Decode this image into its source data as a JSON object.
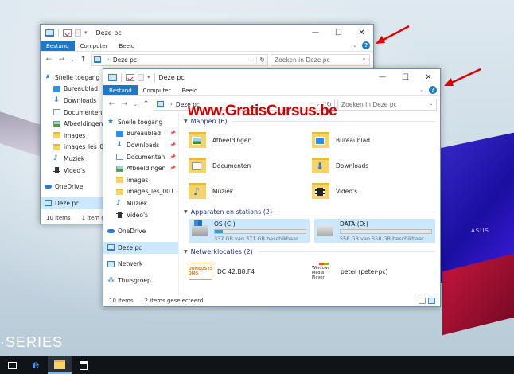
{
  "desktop": {
    "series_text": "SERIES",
    "asus_logo": "ASUS"
  },
  "watermark": "www.GratisCursus.be",
  "accent": "#1979ca",
  "back_window": {
    "title": "Deze pc",
    "ribbon_tabs": [
      "Bestand",
      "Computer",
      "Beeld"
    ],
    "address": "Deze pc",
    "search_placeholder": "Zoeken in Deze pc",
    "nav": [
      {
        "label": "Snelle toegang",
        "icon": "star-icon"
      },
      {
        "label": "Bureaublad",
        "icon": "desktop-icon"
      },
      {
        "label": "Downloads",
        "icon": "download-icon"
      },
      {
        "label": "Documenten",
        "icon": "documents-icon"
      },
      {
        "label": "Afbeeldingen",
        "icon": "pictures-icon"
      },
      {
        "label": "images",
        "icon": "folder-icon"
      },
      {
        "label": "images_les_001",
        "icon": "folder-icon"
      },
      {
        "label": "Muziek",
        "icon": "music-icon"
      },
      {
        "label": "Video's",
        "icon": "video-icon"
      },
      {
        "label": "OneDrive",
        "icon": "cloud-icon"
      },
      {
        "label": "Deze pc",
        "icon": "pc-icon"
      }
    ],
    "status_items": "10 items",
    "status_selected": "1 item ge"
  },
  "front_window": {
    "title": "Deze pc",
    "ribbon_tabs": [
      "Bestand",
      "Computer",
      "Beeld"
    ],
    "address": "Deze pc",
    "search_placeholder": "Zoeken in Deze pc",
    "nav": [
      {
        "label": "Snelle toegang",
        "icon": "star-icon",
        "pinned": false
      },
      {
        "label": "Bureaublad",
        "icon": "desktop-icon",
        "pinned": true
      },
      {
        "label": "Downloads",
        "icon": "download-icon",
        "pinned": true
      },
      {
        "label": "Documenten",
        "icon": "documents-icon",
        "pinned": true
      },
      {
        "label": "Afbeeldingen",
        "icon": "pictures-icon",
        "pinned": true
      },
      {
        "label": "images",
        "icon": "folder-icon",
        "pinned": false
      },
      {
        "label": "images_les_001",
        "icon": "folder-icon",
        "pinned": false
      },
      {
        "label": "Muziek",
        "icon": "music-icon",
        "pinned": false
      },
      {
        "label": "Video's",
        "icon": "video-icon",
        "pinned": false
      },
      {
        "label": "OneDrive",
        "icon": "cloud-icon",
        "pinned": false
      },
      {
        "label": "Deze pc",
        "icon": "pc-icon",
        "pinned": false
      },
      {
        "label": "Netwerk",
        "icon": "network-icon",
        "pinned": false
      },
      {
        "label": "Thuisgroep",
        "icon": "homegroup-icon",
        "pinned": false
      }
    ],
    "groups": {
      "folders_header": "Mappen (6)",
      "folders": [
        {
          "label": "Afbeeldingen",
          "icon": "pictures-folder-icon"
        },
        {
          "label": "Bureaublad",
          "icon": "desktop-folder-icon"
        },
        {
          "label": "Documenten",
          "icon": "documents-folder-icon"
        },
        {
          "label": "Downloads",
          "icon": "downloads-folder-icon"
        },
        {
          "label": "Muziek",
          "icon": "music-folder-icon"
        },
        {
          "label": "Video's",
          "icon": "videos-folder-icon"
        }
      ],
      "drives_header": "Apparaten en stations (2)",
      "drives": [
        {
          "label": "OS (C:)",
          "free": "337 GB van 371 GB beschikbaar",
          "used_fraction": 0.09,
          "icon": "windows-drive-icon"
        },
        {
          "label": "DATA (D:)",
          "free": "558 GB van 558 GB beschikbaar",
          "used_fraction": 0.0,
          "icon": "hard-drive-icon"
        }
      ],
      "netloc_header": "Netwerklocaties (2)",
      "netlocs": [
        {
          "label": "DC 42:B8:F4",
          "icon_text": "DUNEOSYS DMS",
          "icon": "media-server-icon"
        },
        {
          "label": "peter (peter-pc)",
          "icon_text": "Windows Media Player",
          "icon": "windows-media-player-icon"
        }
      ]
    },
    "status_items": "10 items",
    "status_selected": "2 items geselecteerd"
  },
  "taskbar": {
    "buttons": [
      "task-view-icon",
      "edge-icon",
      "file-explorer-icon",
      "store-icon"
    ],
    "edge_glyph": "e"
  }
}
